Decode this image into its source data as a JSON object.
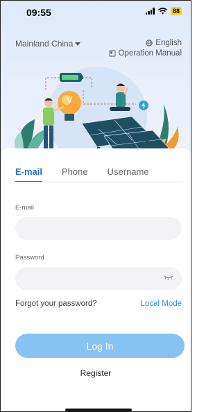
{
  "status_bar": {
    "time": "09:55",
    "battery": "88"
  },
  "header": {
    "region": "Mainland China",
    "language": "English",
    "manual": "Operation Manual"
  },
  "tabs": [
    {
      "label": "E-mail",
      "active": true
    },
    {
      "label": "Phone",
      "active": false
    },
    {
      "label": "Username",
      "active": false
    }
  ],
  "form": {
    "email_label": "E-mail",
    "email_value": "",
    "password_label": "Password",
    "password_value": "",
    "forgot": "Forgot your password?",
    "local_mode": "Local Mode",
    "login": "Log In",
    "register": "Register"
  },
  "colors": {
    "accent": "#1b6fcf",
    "link": "#2d8be0",
    "login_button": "#86c3f3",
    "hero_bg": "#e3ecfa"
  }
}
